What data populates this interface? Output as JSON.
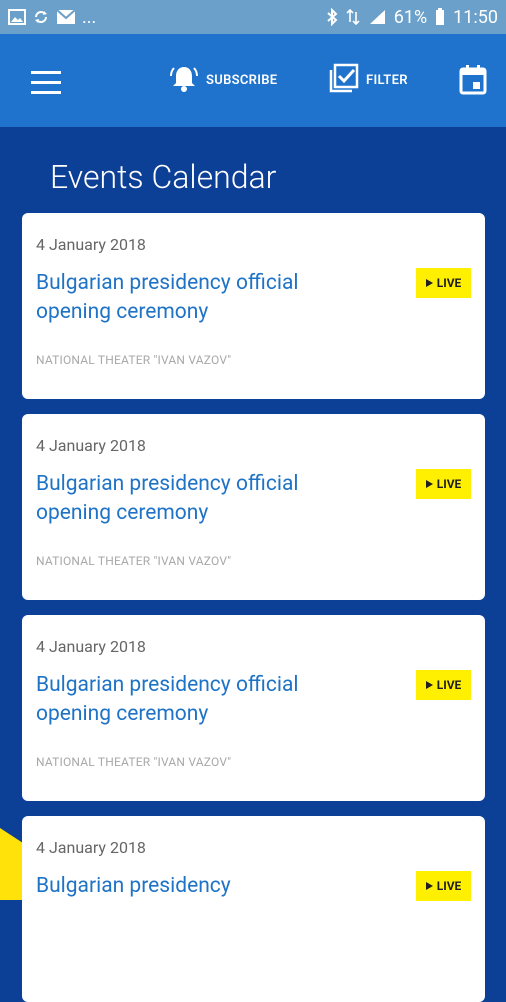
{
  "status": {
    "dots": "...",
    "battery": "61%",
    "time": "11:50"
  },
  "appbar": {
    "subscribe_label": "SUBSCRIBE",
    "filter_label": "FILTER"
  },
  "page_title": "Events Calendar",
  "events": [
    {
      "date": "4 January 2018",
      "title": "Bulgarian presidency official opening ceremony",
      "venue": "NATIONAL THEATER \"IVAN VAZOV\"",
      "live": "LIVE"
    },
    {
      "date": "4 January 2018",
      "title": "Bulgarian presidency official opening ceremony",
      "venue": "NATIONAL THEATER \"IVAN VAZOV\"",
      "live": "LIVE"
    },
    {
      "date": "4 January 2018",
      "title": "Bulgarian presidency official opening ceremony",
      "venue": "NATIONAL THEATER \"IVAN VAZOV\"",
      "live": "LIVE"
    },
    {
      "date": "4 January 2018",
      "title": "Bulgarian presidency",
      "venue": "",
      "live": "LIVE"
    }
  ],
  "colors": {
    "background": "#0c3f96",
    "appbar": "#1f73cc",
    "title_link": "#1f73c6",
    "live_badge": "#ffef00"
  }
}
